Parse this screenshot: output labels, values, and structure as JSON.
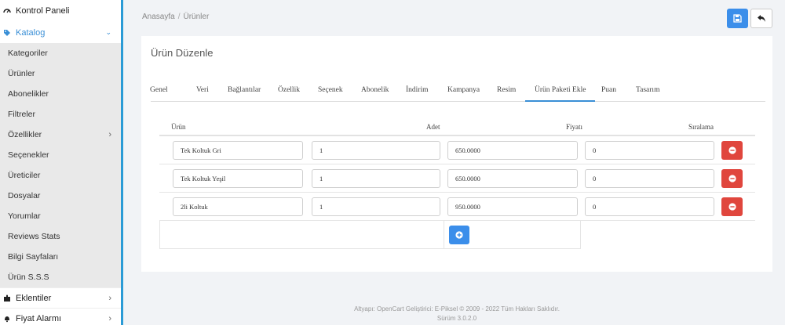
{
  "sidebar": {
    "dashboard": "Kontrol Paneli",
    "catalog": "Katalog",
    "catalog_items": [
      {
        "label": "Kategoriler",
        "has_children": false
      },
      {
        "label": "Ürünler",
        "has_children": false
      },
      {
        "label": "Abonelikler",
        "has_children": false
      },
      {
        "label": "Filtreler",
        "has_children": false
      },
      {
        "label": "Özellikler",
        "has_children": true
      },
      {
        "label": "Seçenekler",
        "has_children": false
      },
      {
        "label": "Üreticiler",
        "has_children": false
      },
      {
        "label": "Dosyalar",
        "has_children": false
      },
      {
        "label": "Yorumlar",
        "has_children": false
      },
      {
        "label": "Reviews Stats",
        "has_children": false
      },
      {
        "label": "Bilgi Sayfaları",
        "has_children": false
      },
      {
        "label": "Ürün S.S.S",
        "has_children": false
      }
    ],
    "extensions": "Eklentiler",
    "price_alarm": "Fiyat Alarmı"
  },
  "breadcrumb": [
    "Anasayfa",
    "Ürünler"
  ],
  "panel": {
    "title": "Ürün Düzenle",
    "tabs": [
      "Genel",
      "Veri",
      "Bağlantılar",
      "Özellik",
      "Seçenek",
      "Abonelik",
      "İndirim",
      "Kampanya",
      "Resim",
      "Ürün Paketi Ekle",
      "Puan",
      "Tasarım"
    ],
    "active_tab": "Ürün Paketi Ekle"
  },
  "table": {
    "headers": {
      "product": "Ürün",
      "qty": "Adet",
      "price": "Fiyatı",
      "order": "Sıralama"
    },
    "rows": [
      {
        "product": "Tek Koltuk Gri",
        "qty": "1",
        "price": "650.0000",
        "order": "0"
      },
      {
        "product": "Tek Koltuk Yeşil",
        "qty": "1",
        "price": "650.0000",
        "order": "0"
      },
      {
        "product": "2li Koltuk",
        "qty": "1",
        "price": "950.0000",
        "order": "0"
      }
    ]
  },
  "footer": {
    "line1": "Altyapı: OpenCart Geliştirici: E-Piksel © 2009 - 2022 Tüm Hakları Saklıdır.",
    "line2": "Sürüm 3.0.2.0"
  },
  "colors": {
    "accent": "#3a8fd6",
    "primary_button": "#3b8eea",
    "danger_button": "#e0463d"
  }
}
